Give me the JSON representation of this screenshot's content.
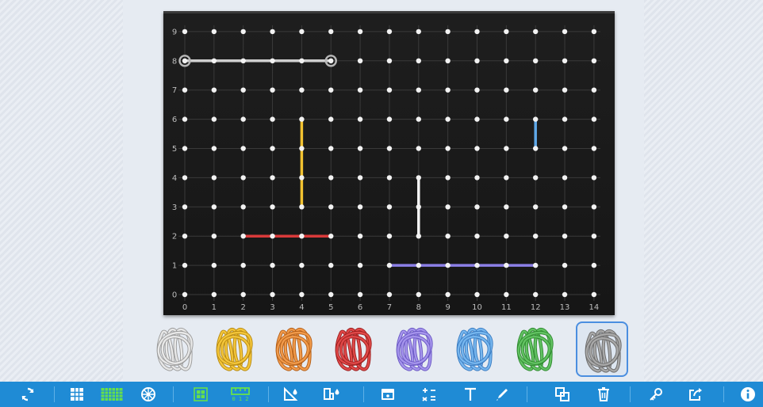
{
  "geoboard": {
    "x_labels": [
      "0",
      "1",
      "2",
      "3",
      "4",
      "5",
      "6",
      "7",
      "8",
      "9",
      "10",
      "11",
      "12",
      "13",
      "14"
    ],
    "y_labels": [
      "0",
      "1",
      "2",
      "3",
      "4",
      "5",
      "6",
      "7",
      "8",
      "9"
    ],
    "bands": [
      {
        "color": "#cfcfcf",
        "points": [
          [
            0,
            8
          ],
          [
            5,
            8
          ]
        ],
        "selected": true
      },
      {
        "color": "#f2c230",
        "points": [
          [
            4,
            3
          ],
          [
            4,
            6
          ]
        ]
      },
      {
        "color": "#d83a3a",
        "points": [
          [
            2,
            2
          ],
          [
            5,
            2
          ]
        ]
      },
      {
        "color": "#f4f4f4",
        "points": [
          [
            8,
            2
          ],
          [
            8,
            4
          ]
        ]
      },
      {
        "color": "#8c7fe6",
        "points": [
          [
            7,
            1
          ],
          [
            12,
            1
          ]
        ]
      },
      {
        "color": "#5fa8e8",
        "points": [
          [
            12,
            5
          ],
          [
            12,
            6
          ]
        ]
      }
    ]
  },
  "palette": [
    {
      "name": "white-band",
      "color": "#e8e8e8",
      "stroke": "#9a9a9a"
    },
    {
      "name": "yellow-band",
      "color": "#f3c53a",
      "stroke": "#b88a10"
    },
    {
      "name": "orange-band",
      "color": "#f19a4a",
      "stroke": "#b45f18"
    },
    {
      "name": "red-band",
      "color": "#e04848",
      "stroke": "#9c1f1f"
    },
    {
      "name": "purple-band",
      "color": "#a594ec",
      "stroke": "#6a58c4"
    },
    {
      "name": "blue-band",
      "color": "#76b6ee",
      "stroke": "#3a7cc2"
    },
    {
      "name": "green-band",
      "color": "#62c262",
      "stroke": "#2f8a2f"
    },
    {
      "name": "gray-band",
      "color": "#a8a8a8",
      "stroke": "#6a6a6a",
      "selected": true
    }
  ],
  "toolbar": {
    "ruler_labels": "0 1 2"
  },
  "colors": {
    "toolbar_bg": "#1f8bd5",
    "accent_green": "#67e04a",
    "selection": "#4a8ee0"
  }
}
